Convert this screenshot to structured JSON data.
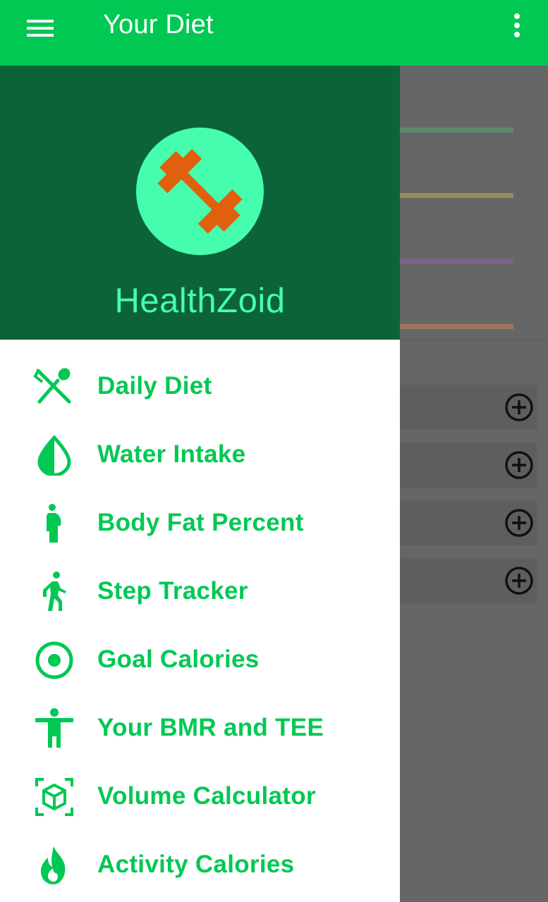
{
  "appbar": {
    "title": "Your Diet",
    "menu_icon": "hamburger-menu-icon",
    "more_icon": "more-vertical-icon",
    "color": "#00c853"
  },
  "drawer": {
    "brand": "HealthZoid",
    "logo_icon": "dumbbell-icon",
    "header_color": "#0c633a",
    "accent_color": "#46fdae",
    "item_color": "#00c853",
    "items": [
      {
        "label": "Daily Diet",
        "icon": "utensils-icon"
      },
      {
        "label": "Water Intake",
        "icon": "water-drop-icon"
      },
      {
        "label": "Body Fat Percent",
        "icon": "pregnant-woman-icon"
      },
      {
        "label": "Step Tracker",
        "icon": "walking-person-icon"
      },
      {
        "label": "Goal Calories",
        "icon": "target-icon"
      },
      {
        "label": "Your BMR and TEE",
        "icon": "accessibility-person-icon"
      },
      {
        "label": "Volume Calculator",
        "icon": "cube-scan-icon"
      },
      {
        "label": "Activity Calories",
        "icon": "flame-icon"
      }
    ]
  },
  "background": {
    "scrim": "dimmed",
    "progress_colors": [
      "#5c8a68",
      "#9a8a5c",
      "#7e6486",
      "#a0765a"
    ],
    "add_buttons": 4,
    "add_icon": "add-circle-icon"
  }
}
